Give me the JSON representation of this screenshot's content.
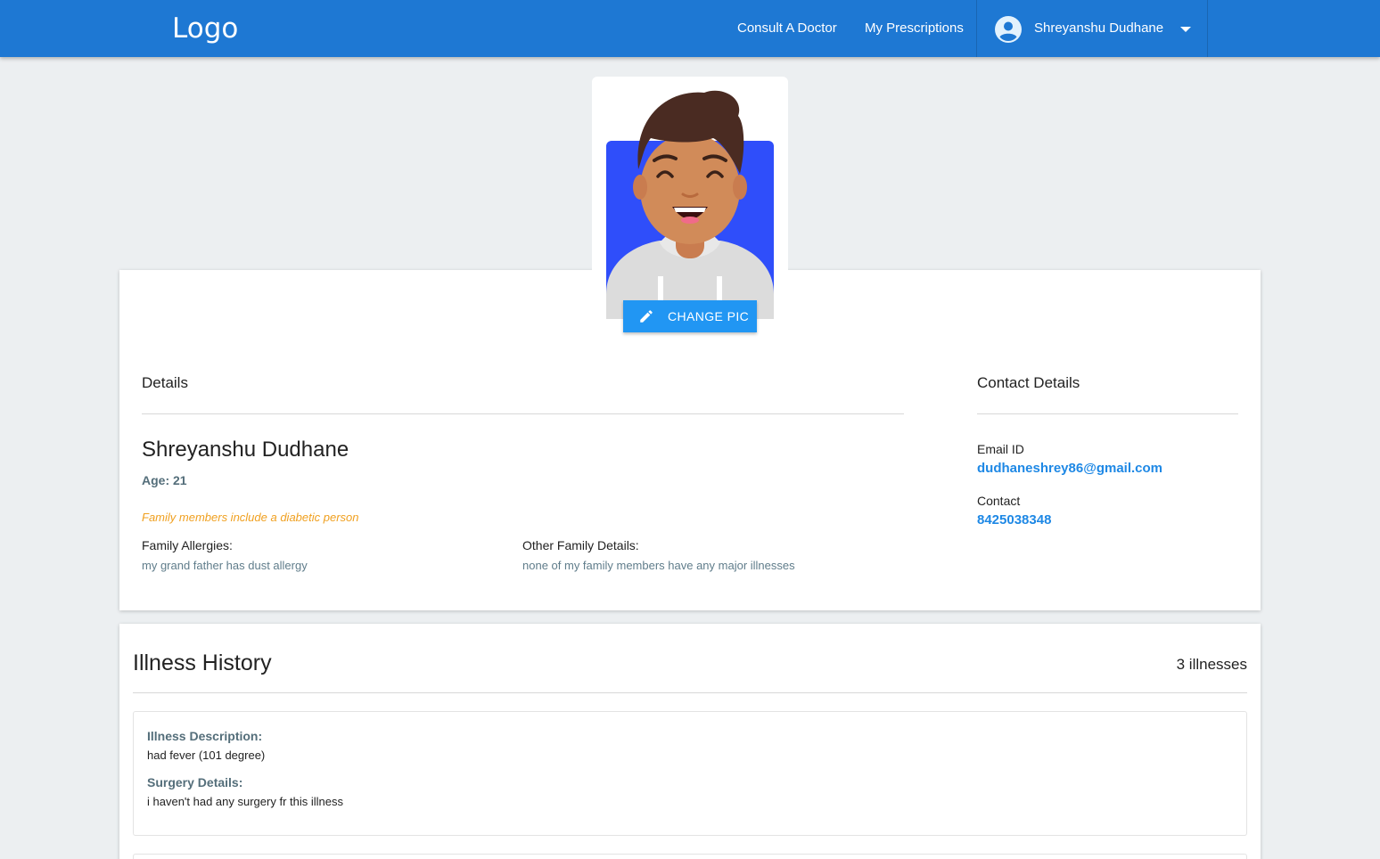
{
  "header": {
    "logo": "Logo",
    "nav": {
      "consult": "Consult A Doctor",
      "prescriptions": "My Prescriptions"
    },
    "user": {
      "name": "Shreyanshu Dudhane",
      "avatar_icon": "account-circle-icon",
      "caret_icon": "chevron-down-icon"
    },
    "color": "#1e78d3"
  },
  "profile": {
    "change_pic_label": "CHANGE PIC",
    "details_heading": "Details",
    "name": "Shreyanshu Dudhane",
    "age_label": "Age:",
    "age_value": "21",
    "diabetic_note": "Family members include a diabetic person",
    "family_allergies_label": "Family Allergies:",
    "family_allergies_value": "my grand father has dust allergy",
    "other_family_label": "Other Family Details:",
    "other_family_value": "none of my family members have any major illnesses"
  },
  "contact": {
    "heading": "Contact Details",
    "email_label": "Email ID",
    "email_value": "dudhaneshrey86@gmail.com",
    "phone_label": "Contact",
    "phone_value": "8425038348"
  },
  "illness": {
    "title": "Illness History",
    "count": "3 illnesses",
    "items": [
      {
        "desc_label": "Illness Description:",
        "desc_value": "had fever (101 degree)",
        "surgery_label": "Surgery Details:",
        "surgery_value": "i haven't had any surgery fr this illness"
      }
    ]
  },
  "colors": {
    "accent": "#2196f3",
    "link": "#1e88e5",
    "warning": "#f0a020",
    "muted": "#607d8b"
  }
}
